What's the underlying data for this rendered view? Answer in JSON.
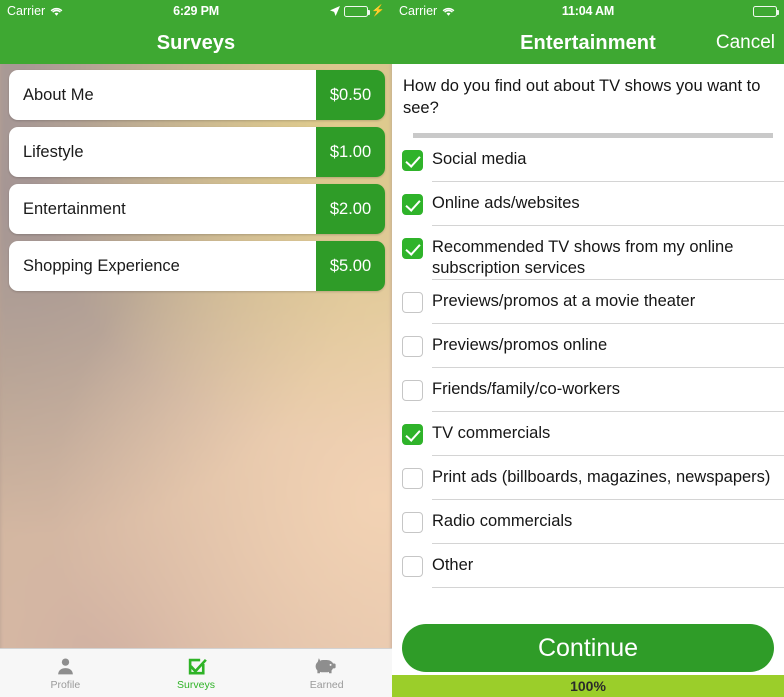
{
  "left": {
    "status_bar": {
      "carrier": "Carrier",
      "wifi_icon": "wifi-icon",
      "time": "6:29 PM",
      "location_icon": "location-arrow-icon",
      "battery_icon": "battery-icon",
      "charging_icon": "lightning-bolt-icon"
    },
    "nav": {
      "title": "Surveys"
    },
    "surveys": [
      {
        "name": "About Me",
        "price": "$0.50"
      },
      {
        "name": "Lifestyle",
        "price": "$1.00"
      },
      {
        "name": "Entertainment",
        "price": "$2.00"
      },
      {
        "name": "Shopping Experience",
        "price": "$5.00"
      }
    ],
    "tabs": [
      {
        "label": "Profile",
        "icon": "person-icon",
        "active": false
      },
      {
        "label": "Surveys",
        "icon": "checkbox-check-icon",
        "active": true
      },
      {
        "label": "Earned",
        "icon": "piggy-bank-icon",
        "active": false
      }
    ]
  },
  "right": {
    "status_bar": {
      "carrier": "Carrier",
      "wifi_icon": "wifi-icon",
      "time": "11:04 AM",
      "battery_icon": "battery-icon"
    },
    "nav": {
      "title": "Entertainment",
      "cancel_label": "Cancel"
    },
    "question": "How do you find out about TV shows you want to see?",
    "options": [
      {
        "label": "Social media",
        "checked": true
      },
      {
        "label": "Online ads/websites",
        "checked": true
      },
      {
        "label": "Recommended TV shows from my online subscription services",
        "checked": true
      },
      {
        "label": "Previews/promos at a movie theater",
        "checked": false
      },
      {
        "label": "Previews/promos online",
        "checked": false
      },
      {
        "label": "Friends/family/co-workers",
        "checked": false
      },
      {
        "label": "TV commercials",
        "checked": true
      },
      {
        "label": "Print ads (billboards, magazines, newspapers)",
        "checked": false
      },
      {
        "label": "Radio commercials",
        "checked": false
      },
      {
        "label": "Other",
        "checked": false
      }
    ],
    "continue_label": "Continue",
    "progress": {
      "label": "100%",
      "percent": 100
    }
  },
  "colors": {
    "header_green": "#3ea832",
    "badge_green": "#2f9c28",
    "check_green": "#2fb32a",
    "progress_green": "#9bce2a"
  }
}
